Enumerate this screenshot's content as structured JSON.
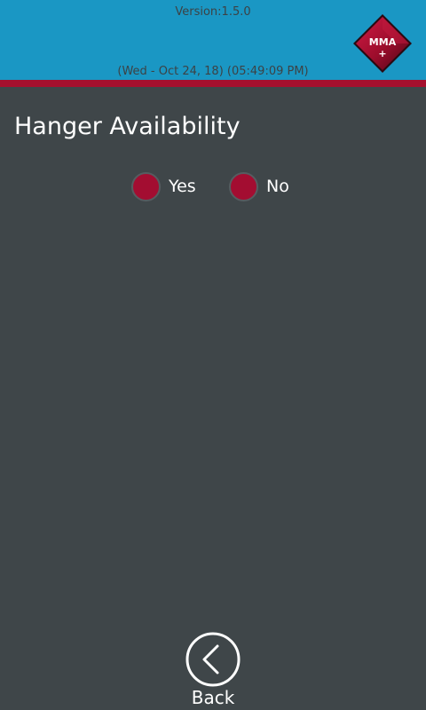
{
  "header": {
    "version": "Version:1.5.0",
    "datetime": "(Wed - Oct 24, 18) (05:49:09 PM)",
    "logo_text": "MMA",
    "logo_subtext": "+"
  },
  "page": {
    "title": "Hanger Availability"
  },
  "radio_options": [
    {
      "label": "Yes"
    },
    {
      "label": "No"
    }
  ],
  "footer": {
    "back_label": "Back"
  },
  "colors": {
    "header_bg": "#1a97c4",
    "accent_red": "#a5102e",
    "page_bg": "#3f4649"
  }
}
